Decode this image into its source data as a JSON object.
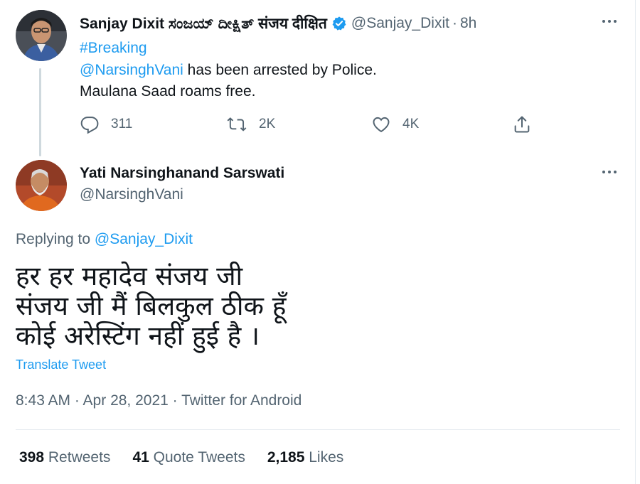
{
  "parent_tweet": {
    "author_name": "Sanjay Dixit ಸಂಜಯ್ ದೀಕ್ಷಿತ್ संजय दीक्षित",
    "handle": "@Sanjay_Dixit",
    "separator": "·",
    "time": "8h",
    "hashtag": "#Breaking",
    "mention": "@NarsinghVani",
    "line1_rest": " has been arrested by Police.",
    "line2": "Maulana Saad roams free.",
    "replies": "311",
    "retweets": "2K",
    "likes": "4K",
    "verified_color": "#1d9bf0"
  },
  "main_tweet": {
    "author_name": "Yati Narsinghanand Sarswati",
    "handle": "@NarsinghVani",
    "replying_prefix": "Replying to ",
    "replying_handle": "@Sanjay_Dixit",
    "lines": [
      "हर हर महादेव संजय जी",
      "संजय जी मैं बिलकुल ठीक हूँ",
      "कोई अरेस्टिंग नहीं हुई है ।"
    ],
    "translate_label": "Translate Tweet",
    "meta": "8:43 AM · Apr 28, 2021 · Twitter for Android",
    "stats": {
      "retweets_count": "398",
      "retweets_label": "Retweets",
      "quotes_count": "41",
      "quotes_label": "Quote Tweets",
      "likes_count": "2,185",
      "likes_label": "Likes"
    }
  },
  "icons": {
    "more": "more-icon",
    "reply": "reply-icon",
    "retweet": "retweet-icon",
    "like": "heart-icon",
    "share": "share-icon",
    "verified": "verified-badge-icon"
  },
  "colors": {
    "link": "#1d9bf0",
    "secondary": "#536471",
    "text": "#0f1419"
  }
}
